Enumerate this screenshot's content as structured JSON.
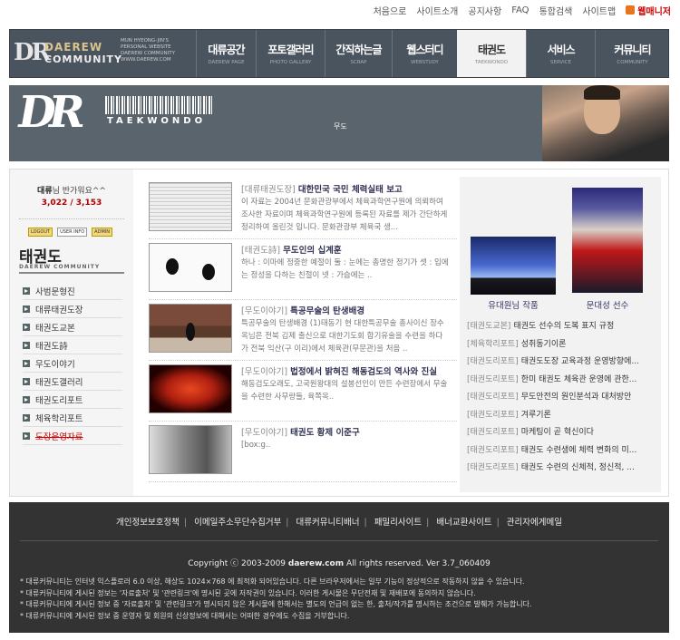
{
  "toplinks": [
    {
      "label": "처음으로"
    },
    {
      "label": "사이트소개"
    },
    {
      "label": "공지사항"
    },
    {
      "label": "FAQ"
    },
    {
      "label": "통합검색"
    },
    {
      "label": "사이트맵"
    }
  ],
  "rss_label": "웹매니저",
  "logo": {
    "mark": "DR",
    "line1": "DAEREW",
    "line2": "COMMUNITY"
  },
  "personal": [
    "MUN HYEONG-JIN'S",
    "PERSONAL WEBSITE",
    "DAEREW COMMUNITY",
    "WWW.DAEREW.COM"
  ],
  "menu": [
    {
      "ko": "대류공간",
      "en": "DAEREW PAGE",
      "active": false
    },
    {
      "ko": "포토갤러리",
      "en": "PHOTO GALLERY",
      "active": false
    },
    {
      "ko": "간직하는글",
      "en": "SCRAP",
      "active": false
    },
    {
      "ko": "웹스터디",
      "en": "WEBSTUDY",
      "active": false
    },
    {
      "ko": "태권도",
      "en": "TAEKWONDO",
      "active": true
    },
    {
      "ko": "서비스",
      "en": "SERVICE",
      "active": false
    },
    {
      "ko": "커뮤니티",
      "en": "COMMUNITY",
      "active": false
    }
  ],
  "banner": {
    "mark": "DR",
    "title": "TAEKWONDO",
    "caption": "무도"
  },
  "sidebar": {
    "greet_name": "대류",
    "greet_text": "님 반가워요^^",
    "counts": "3,022 / 3,153",
    "buttons": [
      "LOGOUT",
      "USER INFO",
      "ADMIN"
    ],
    "title": "태권도",
    "subtitle": "DAEREW COMMUNITY",
    "items": [
      {
        "label": "사범문형진",
        "struck": false
      },
      {
        "label": "대류태권도장",
        "struck": false
      },
      {
        "label": "태권도교본",
        "struck": false
      },
      {
        "label": "태권도詩",
        "struck": false
      },
      {
        "label": "무도이야기",
        "struck": false
      },
      {
        "label": "태권도갤러리",
        "struck": false
      },
      {
        "label": "태권도리포트",
        "struck": false
      },
      {
        "label": "체육학리포트",
        "struck": false
      },
      {
        "label": "도장운영자료",
        "struck": true
      }
    ]
  },
  "articles": [
    {
      "cat": "[대류태권도장]",
      "title": "대한민국 국민 체력실태 보고",
      "text": "이 자료는 2004년 문화관광부에서 체육과학연구원에 의뢰하여 조사한 자료이며 체육과학연구원에 등록된 자료를 제가 간단하게 정리하여 올린것 입니다. 문화관광부 체육국 생..."
    },
    {
      "cat": "[태권도詩]",
      "title": "무도인의 십계훈",
      "text": "하나 : 이마에 정중한 예절이   둘 : 눈에는 총명한 정기가   셋 : 입에는 정성을 다하는 친절이   넷 : 가슴에는 .."
    },
    {
      "cat": "[무도이야기]",
      "title": "특공무술의 탄생배경",
      "text": "특공무술의 탄생배경 (1)태동기 현 대한특공무술 총사이신 장수옥님은 전북 김제 출신으로 대한기도회 합기유술을 수련을 하다가 전북 익산(구 이리)에서 체육관(무문관)을 처음 .."
    },
    {
      "cat": "[무도이야기]",
      "title": "법정에서 밝혀진 해동검도의 역사와 진실",
      "text": "해동검도오래도, 고국원왕대의 설봉선인이 만든 수련장에서 무술을 수련한 사무랑들, 육쪽옥.."
    },
    {
      "cat": "[무도이야기]",
      "title": "태권도 황제 이준구",
      "text": "[box:g.."
    }
  ],
  "right": {
    "cap1": "유대원님 작품",
    "cap2": "문대성 선수",
    "items": [
      {
        "cat": "[태권도교본]",
        "title": "태권도 선수의 도복 표지 규정"
      },
      {
        "cat": "[체육학리포트]",
        "title": "성취동기이론"
      },
      {
        "cat": "[태권도리포트]",
        "title": "태권도도장 교육과정 운영방향에..."
      },
      {
        "cat": "[태권도리포트]",
        "title": "한미 태권도 체육관 운영에 관한..."
      },
      {
        "cat": "[태권도리포트]",
        "title": "무도안전의 원인분석과 대처방안"
      },
      {
        "cat": "[태권도리포트]",
        "title": "겨루기론"
      },
      {
        "cat": "[태권도리포트]",
        "title": "마케팅이 곧 혁신이다"
      },
      {
        "cat": "[태권도리포트]",
        "title": "태권도 수련생에 체력 변화의 미..."
      },
      {
        "cat": "[태권도리포트]",
        "title": "태권도 수련의 신체적, 정신적, ..."
      }
    ]
  },
  "footer": {
    "links": [
      "개인정보보호정책",
      "이메일주소무단수집거부",
      "대류커뮤니티배너",
      "패밀리사이트",
      "배너교환사이트",
      "관리자에게메일"
    ],
    "copy_pre": "Copyright ⓒ 2003-2009 ",
    "copy_site": "daerew.com",
    "copy_post": " All rights reserved. Ver 3.7_060409",
    "notes": [
      "* 대류커뮤니티는 인터넷 익스플로러 6.0 이상, 해상도 1024×768 에 최적화 되어있습니다. 다른 브라우저에서는 일부 기능이 정상적으로 작동하지 않을 수 있습니다.",
      "* 대류커뮤니티에 게시된 정보는 '자료출처' 및 '관련링크'에 명시된 곳에 저작권이 있습니다. 이러한 게시물은 무단전재 및 재배포에 동의하지 않습니다.",
      "* 대류커뮤니티에 게시된 정보 중 '자료출처' 및 '관련링크'가 명시되지 않은 게시물에 한해서는 별도의 언급이 없는 한, 출처/작가를 명시하는 조건으로 발췌가 가능합니다.",
      "* 대류커뮤니티에 게시된 정보 중 운영자 및 회원의 신상정보에 대해서는 어떠한 경우에도 수집을 거부합니다."
    ]
  }
}
